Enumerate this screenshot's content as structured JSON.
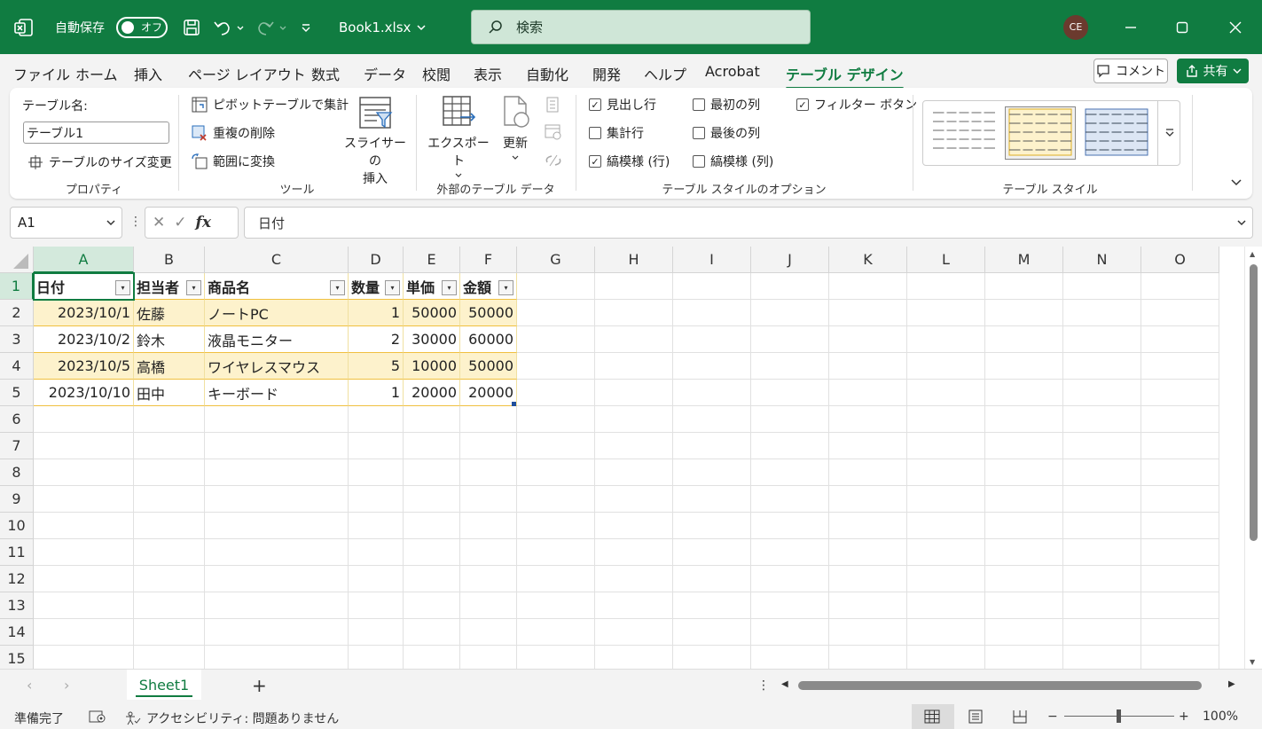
{
  "titlebar": {
    "autosave_label": "自動保存",
    "autosave_state": "オフ",
    "filename": "Book1.xlsx",
    "search_placeholder": "検索",
    "user_initials": "CE"
  },
  "menu": {
    "tabs": [
      "ファイル",
      "ホーム",
      "挿入",
      "ページ レイアウト",
      "数式",
      "データ",
      "校閲",
      "表示",
      "自動化",
      "開発",
      "ヘルプ",
      "Acrobat",
      "テーブル デザイン"
    ],
    "active_tab": "テーブル デザイン",
    "comment_label": "コメント",
    "share_label": "共有"
  },
  "ribbon": {
    "properties": {
      "label": "プロパティ",
      "table_name_label": "テーブル名:",
      "table_name_value": "テーブル1",
      "resize_label": "テーブルのサイズ変更"
    },
    "tools": {
      "label": "ツール",
      "pivot": "ピボットテーブルで集計",
      "remove_dup": "重複の削除",
      "convert_range": "範囲に変換",
      "slicer_line1": "スライサーの",
      "slicer_line2": "挿入"
    },
    "external": {
      "label": "外部のテーブル データ",
      "export": "エクスポート",
      "refresh": "更新"
    },
    "style_options": {
      "label": "テーブル スタイルのオプション",
      "header_row": "見出し行",
      "total_row": "集計行",
      "banded_rows": "縞模様 (行)",
      "first_col": "最初の列",
      "last_col": "最後の列",
      "banded_cols": "縞模様 (列)",
      "filter_btn": "フィルター ボタン",
      "header_row_checked": true,
      "total_row_checked": false,
      "banded_rows_checked": true,
      "first_col_checked": false,
      "last_col_checked": false,
      "banded_cols_checked": false,
      "filter_btn_checked": true
    },
    "table_styles": {
      "label": "テーブル スタイル"
    }
  },
  "formula_bar": {
    "name_box": "A1",
    "fx": "fx",
    "formula": "日付"
  },
  "grid": {
    "columns": [
      "A",
      "B",
      "C",
      "D",
      "E",
      "F",
      "G",
      "H",
      "I",
      "J",
      "K",
      "L",
      "M",
      "N",
      "O"
    ],
    "rows": [
      "1",
      "2",
      "3",
      "4",
      "5",
      "6",
      "7",
      "8",
      "9",
      "10",
      "11",
      "12",
      "13",
      "14",
      "15"
    ],
    "table_headers": [
      "日付",
      "担当者",
      "商品名",
      "数量",
      "単価",
      "金額"
    ],
    "table_rows": [
      [
        "2023/10/1",
        "佐藤",
        "ノートPC",
        "1",
        "50000",
        "50000"
      ],
      [
        "2023/10/2",
        "鈴木",
        "液晶モニター",
        "2",
        "30000",
        "60000"
      ],
      [
        "2023/10/5",
        "高橋",
        "ワイヤレスマウス",
        "5",
        "10000",
        "50000"
      ],
      [
        "2023/10/10",
        "田中",
        "キーボード",
        "1",
        "20000",
        "20000"
      ]
    ]
  },
  "sheets": {
    "tabs": [
      "Sheet1"
    ],
    "add_label": "+"
  },
  "status": {
    "ready": "準備完了",
    "accessibility": "アクセシビリティ: 問題ありません",
    "zoom": "100%",
    "zoom_minus": "−",
    "zoom_plus": "+"
  },
  "colors": {
    "accent": "#107c41",
    "table_band": "#fdf2cc",
    "table_border": "#f0c040"
  }
}
